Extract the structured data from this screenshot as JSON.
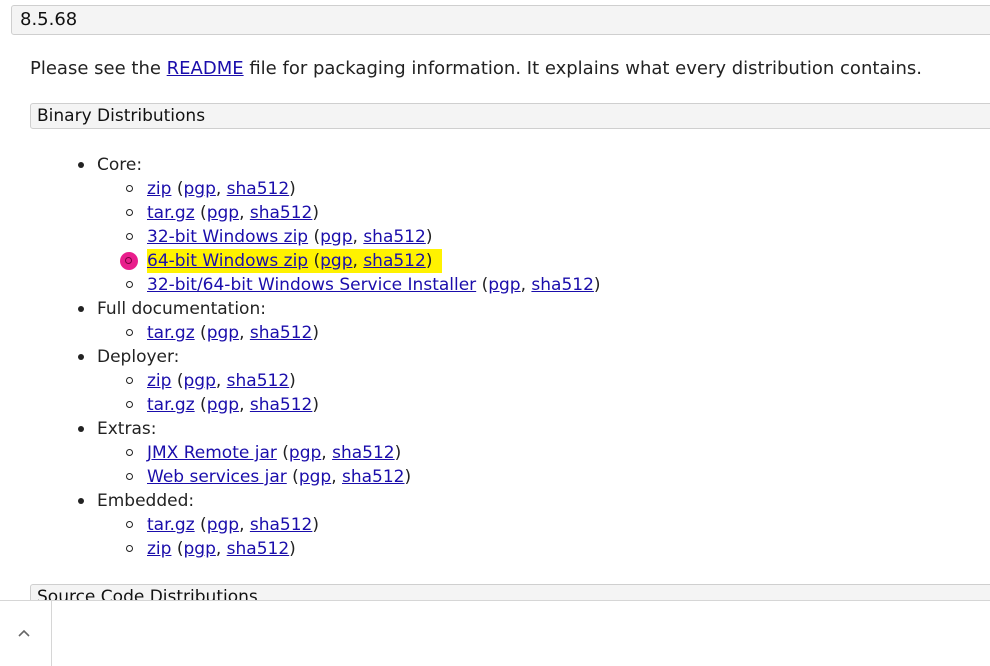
{
  "version": "8.5.68",
  "intro": {
    "before": "Please see the ",
    "link": "README",
    "after": " file for packaging information. It explains what every distribution contains."
  },
  "sections": {
    "binary": "Binary Distributions",
    "source": "Source Code Distributions"
  },
  "categories": {
    "core": {
      "label": "Core:",
      "items": [
        {
          "main": "zip",
          "pgp": "pgp",
          "sha": "sha512"
        },
        {
          "main": "tar.gz",
          "pgp": "pgp",
          "sha": "sha512"
        },
        {
          "main": "32-bit Windows zip",
          "pgp": "pgp",
          "sha": "sha512"
        },
        {
          "main": "64-bit Windows zip",
          "pgp": "pgp",
          "sha": "sha512"
        },
        {
          "main": "32-bit/64-bit Windows Service Installer",
          "pgp": "pgp",
          "sha": "sha512"
        }
      ]
    },
    "docs": {
      "label": "Full documentation:",
      "items": [
        {
          "main": "tar.gz",
          "pgp": "pgp",
          "sha": "sha512"
        }
      ]
    },
    "deployer": {
      "label": "Deployer:",
      "items": [
        {
          "main": "zip",
          "pgp": "pgp",
          "sha": "sha512"
        },
        {
          "main": "tar.gz",
          "pgp": "pgp",
          "sha": "sha512"
        }
      ]
    },
    "extras": {
      "label": "Extras:",
      "items": [
        {
          "main": "JMX Remote jar",
          "pgp": "pgp",
          "sha": "sha512"
        },
        {
          "main": "Web services jar",
          "pgp": "pgp",
          "sha": "sha512"
        }
      ]
    },
    "embedded": {
      "label": "Embedded:",
      "items": [
        {
          "main": "tar.gz",
          "pgp": "pgp",
          "sha": "sha512"
        },
        {
          "main": "zip",
          "pgp": "pgp",
          "sha": "sha512"
        }
      ]
    }
  },
  "punct": {
    "open": " (",
    "comma": ", ",
    "close": ")"
  },
  "colors": {
    "link": "#1a0dab",
    "highlight": "#fff200",
    "marker": "#e91e8c"
  },
  "icons": {
    "collapse": "chevron-up-icon"
  }
}
